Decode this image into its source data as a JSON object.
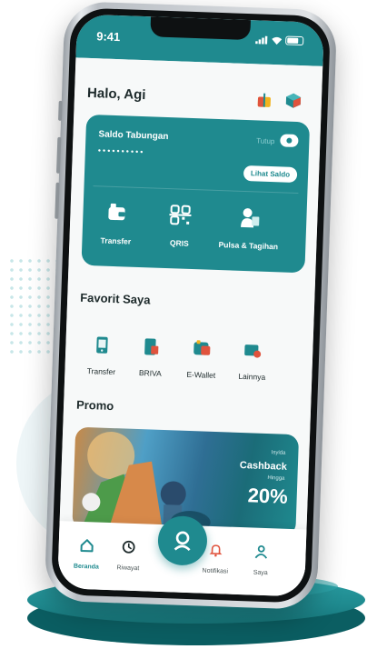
{
  "status": {
    "time": "9:41"
  },
  "header": {
    "greeting": "Halo, Agi",
    "icons": [
      "gift-icon",
      "cube-icon"
    ]
  },
  "saldo": {
    "label": "Saldo Tabungan",
    "masked_balance": "••••••••••",
    "eye_label": "Tutup",
    "button": "Lihat Saldo"
  },
  "quick_actions": [
    {
      "label": "Transfer",
      "icon": "wallet-icon"
    },
    {
      "label": "QRIS",
      "icon": "qr-icon"
    },
    {
      "label": "Pulsa & Tagihan",
      "icon": "bill-icon"
    }
  ],
  "favorit": {
    "title": "Favorit Saya",
    "items": [
      {
        "label": "Transfer",
        "icon": "phone-transfer-icon"
      },
      {
        "label": "BRIVA",
        "icon": "briva-icon"
      },
      {
        "label": "E-Wallet",
        "icon": "ewallet-icon"
      },
      {
        "label": "Lainnya",
        "icon": "more-icon"
      }
    ]
  },
  "promo": {
    "title": "Promo",
    "small_text": "Isyida",
    "headline": "Cashback",
    "upto": "Hingga",
    "percent": "20%"
  },
  "nav": {
    "items": [
      {
        "label": "Beranda",
        "icon": "home-icon",
        "active": true
      },
      {
        "label": "Riwayat",
        "icon": "history-icon",
        "active": false
      },
      {
        "label": "Notifikasi",
        "icon": "bell-icon",
        "active": false
      },
      {
        "label": "Saya",
        "icon": "user-icon",
        "active": false
      }
    ],
    "center_icon": "scan-icon"
  },
  "colors": {
    "primary": "#1f8a8f",
    "text": "#1d2a2b",
    "background": "#f7f9f9"
  }
}
